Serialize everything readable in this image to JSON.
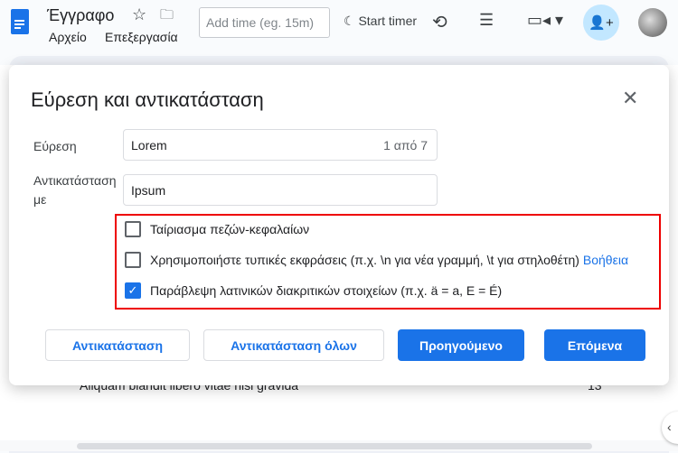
{
  "header": {
    "doc_title": "Έγγραφο",
    "menus": [
      "Αρχείο",
      "Επεξεργασία"
    ],
    "add_time_placeholder": "Add time (eg. 15m)",
    "start_timer": "Start timer"
  },
  "document": {
    "row_text": "Aliquam blandit libero vitae nisi gravida",
    "row_number": "13"
  },
  "dialog": {
    "title": "Εύρεση και αντικατάσταση",
    "find_label": "Εύρεση",
    "find_value": "Lorem",
    "match_count": "1 από 7",
    "replace_label": "Αντικατάσταση με",
    "replace_value": "Ipsum",
    "options": [
      {
        "label": "Ταίριασμα πεζών-κεφαλαίων",
        "checked": false
      },
      {
        "label": "Χρησιμοποιήστε τυπικές εκφράσεις (π.χ. \\n για νέα γραμμή, \\t για στηλοθέτη)",
        "checked": false,
        "link": "Βοήθεια"
      },
      {
        "label": "Παράβλεψη λατινικών διακριτικών στοιχείων (π.χ. ä = a, E = É)",
        "checked": true
      }
    ],
    "buttons": {
      "replace": "Αντικατάσταση",
      "replace_all": "Αντικατάσταση όλων",
      "previous": "Προηγούμενο",
      "next": "Επόμενα"
    }
  },
  "colors": {
    "accent": "#1a73e8",
    "highlight_box": "#e00000"
  }
}
